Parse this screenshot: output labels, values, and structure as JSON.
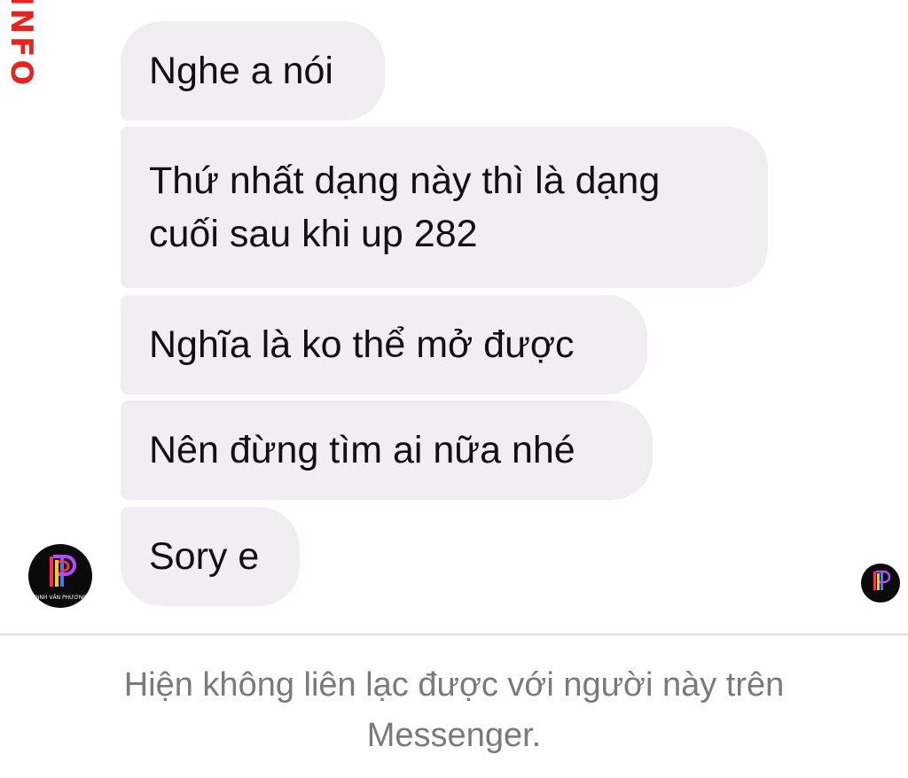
{
  "watermark": {
    "text": "INFO"
  },
  "messages": [
    {
      "text": "Nghe a nói"
    },
    {
      "text": "Thứ nhất dạng này thì là dạng cuối sau khi up 282"
    },
    {
      "text": "Nghĩa là ko thể mở được"
    },
    {
      "text": "Nên đừng tìm ai nữa nhé"
    },
    {
      "text": "Sory e"
    }
  ],
  "avatar": {
    "caption": "ĐINH VĂN PHƯƠNG",
    "icon": "logo-p-icon",
    "colors": [
      "#ff2d55",
      "#ffcc00",
      "#3d7bff",
      "#b04bff"
    ]
  },
  "status": {
    "text": "Hiện không liên lạc được với người này trên Messenger."
  },
  "colors": {
    "bubble": "#f1eef2",
    "watermark": "#e8231f",
    "notice_text": "#7a7a7a"
  }
}
